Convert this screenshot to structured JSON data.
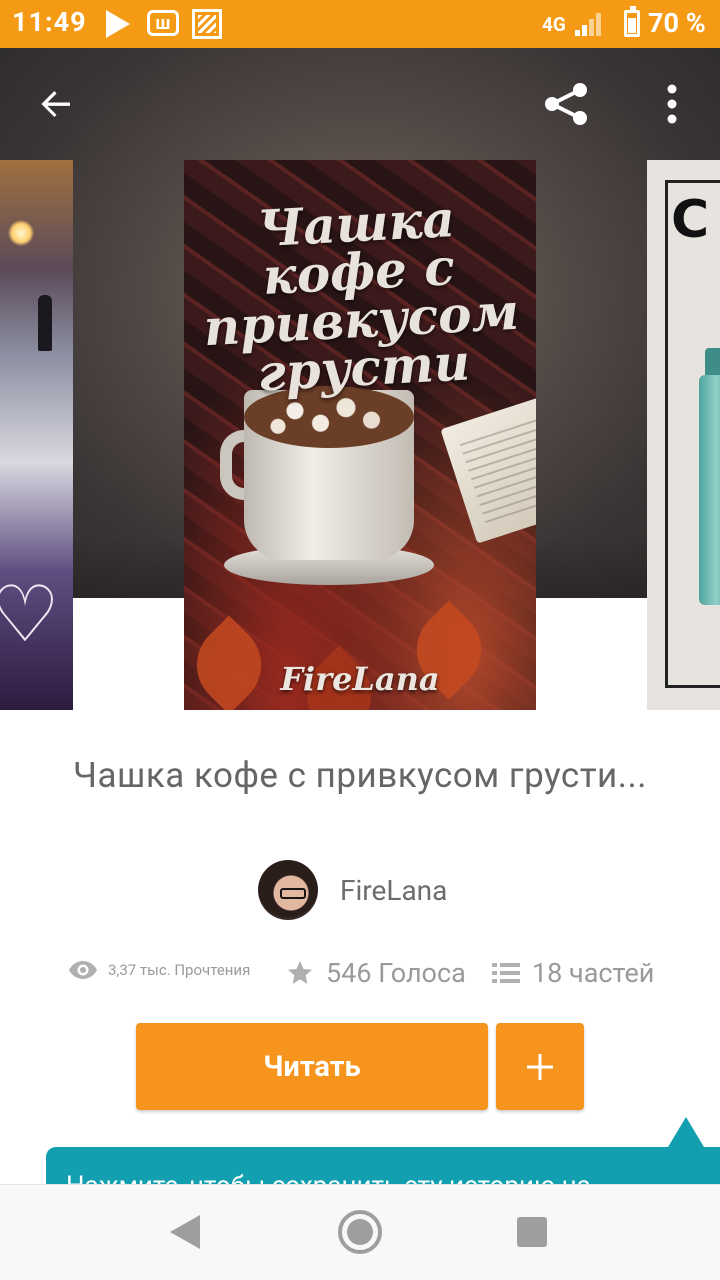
{
  "status_bar": {
    "time": "11:49",
    "network": "4G",
    "battery": "70 %",
    "battery_level": 0.7
  },
  "toolbar": {
    "back_icon": "arrow-back-icon",
    "share_icon": "share-icon",
    "more_icon": "more-vert-icon"
  },
  "covers": {
    "main": {
      "title": "Чашка кофе с привкусом грусти",
      "author": "FireLana"
    }
  },
  "book": {
    "title": "Чашка кофе с привкусом грусти...",
    "author": "FireLana"
  },
  "stats": {
    "reads": "3,37 тыс. Прочтения",
    "votes": "546 Голоса",
    "parts": "18 частей"
  },
  "actions": {
    "read_label": "Читать",
    "add_label": "+"
  },
  "tooltip": {
    "text": "Нажмите, чтобы сохранить эту историю на"
  },
  "colors": {
    "accent": "#f7941d",
    "status_bar": "#f59a14",
    "tooltip": "#12a0b0",
    "text_muted": "#9a9a9a"
  }
}
